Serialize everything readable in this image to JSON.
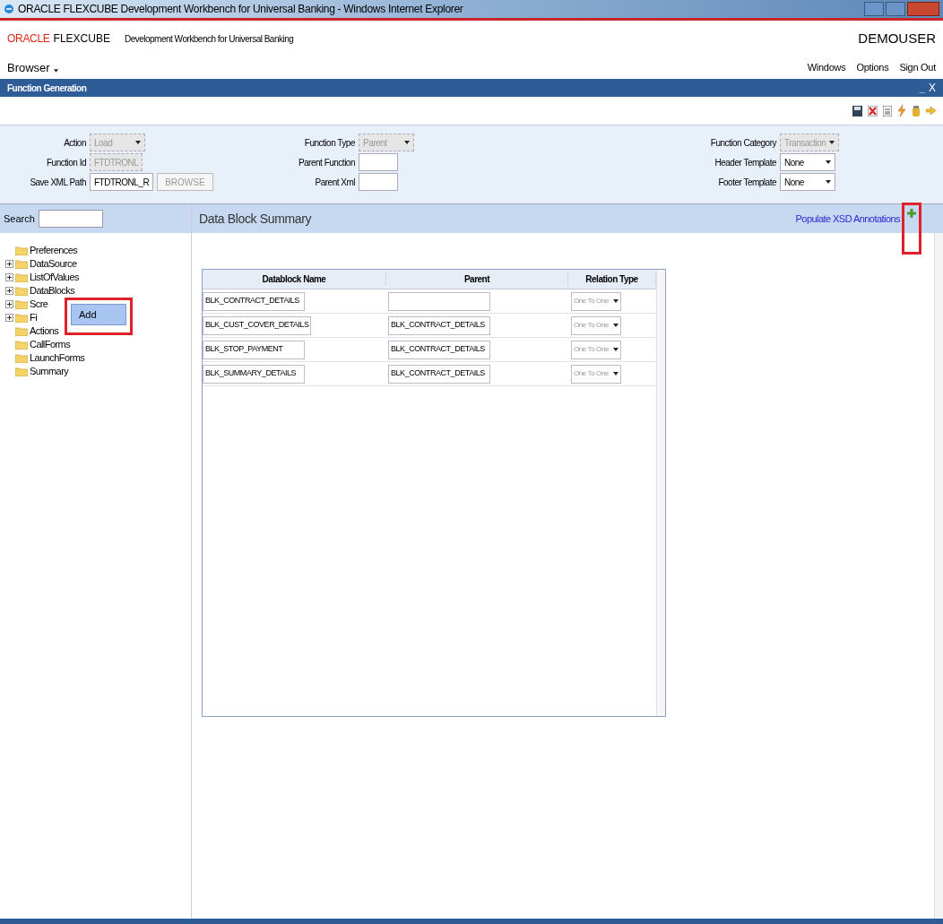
{
  "window": {
    "title": "ORACLE FLEXCUBE Development Workbench for Universal Banking - Windows Internet Explorer"
  },
  "header": {
    "brand": "ORACLE",
    "product": "FLEXCUBE",
    "subtitle": "Development Workbench for Universal Banking",
    "user": "DEMOUSER"
  },
  "menubar": {
    "browser": "Browser",
    "links": [
      "Windows",
      "Options",
      "Sign Out"
    ]
  },
  "panel": {
    "title": "Function Generation",
    "minimize": "_",
    "close": "X"
  },
  "form": {
    "left": [
      {
        "label": "Action",
        "kind": "select",
        "value": "Load",
        "disabled": true
      },
      {
        "label": "Function Id",
        "kind": "input",
        "value": "FTDTRONL",
        "disabled": true
      },
      {
        "label": "Save XML Path",
        "kind": "input-button",
        "value": "FTDTRONL_R",
        "button": "BROWSE",
        "disabled": false
      }
    ],
    "middle": [
      {
        "label": "Function Type",
        "kind": "select",
        "value": "Parent",
        "disabled": true
      },
      {
        "label": "Parent Function",
        "kind": "input",
        "disabled": false
      },
      {
        "label": "Parent Xml",
        "kind": "input",
        "disabled": false
      }
    ],
    "right": [
      {
        "label": "Function Category",
        "kind": "select",
        "value": "Transaction",
        "disabled": true
      },
      {
        "label": "Header Template",
        "kind": "select",
        "value": "None",
        "disabled": false
      },
      {
        "label": "Footer Template",
        "kind": "select",
        "value": "None",
        "disabled": false
      }
    ]
  },
  "search": {
    "label": "Search"
  },
  "tree": [
    {
      "label": "Preferences",
      "expandable": false
    },
    {
      "label": "DataSource",
      "expandable": true
    },
    {
      "label": "ListOfValues",
      "expandable": true
    },
    {
      "label": "DataBlocks",
      "expandable": true
    },
    {
      "label": "Scre",
      "expandable": true
    },
    {
      "label": "Fi",
      "expandable": true
    },
    {
      "label": "Actions",
      "expandable": false
    },
    {
      "label": "CallForms",
      "expandable": false
    },
    {
      "label": "LaunchForms",
      "expandable": false
    },
    {
      "label": "Summary",
      "expandable": false
    }
  ],
  "context_menu": {
    "items": [
      "Add"
    ]
  },
  "summary": {
    "title": "Data Block Summary",
    "link": "Populate XSD Annotations",
    "columns": [
      "Datablock Name",
      "Parent",
      "Relation Type"
    ],
    "rows": [
      {
        "name": "BLK_CONTRACT_DETAILS",
        "relation": "One To One"
      },
      {
        "name": "BLK_CUST_COVER_DETAILS",
        "parent": "BLK_CONTRACT_DETAILS",
        "relation": "One To One"
      },
      {
        "name": "BLK_STOP_PAYMENT",
        "parent": "BLK_CONTRACT_DETAILS",
        "relation": "One To One"
      },
      {
        "name": "BLK_SUMMARY_DETAILS",
        "parent": "BLK_CONTRACT_DETAILS",
        "relation": "One To One"
      }
    ]
  }
}
